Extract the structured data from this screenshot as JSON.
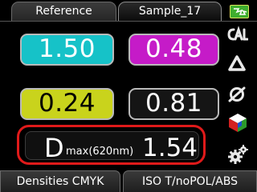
{
  "tabs": [
    {
      "label": "Reference",
      "active": false
    },
    {
      "label": "Sample_17",
      "active": true
    }
  ],
  "densities": {
    "cyan": {
      "value": "1.50",
      "color": "#16c2c8"
    },
    "magenta": {
      "value": "0.48",
      "color": "#c51bc8"
    },
    "yellow": {
      "value": "0.24",
      "color": "#c9d31c"
    },
    "black": {
      "value": "0.81",
      "color": "#151515"
    }
  },
  "dmax": {
    "label": "D",
    "subscript": "max(620nm)",
    "value": "1.54",
    "highlight_color": "#e01a1a"
  },
  "side_icons": [
    "cal-icon",
    "delta-triangle-icon",
    "rotate-icon",
    "color-cube-icon",
    "settings-gears-icon"
  ],
  "status": {
    "battery_icon": "battery-charging-icon"
  },
  "bottom_bar": {
    "mode_label": "Densities CMYK",
    "standard_label": "ISO T/noPOL/ABS"
  }
}
